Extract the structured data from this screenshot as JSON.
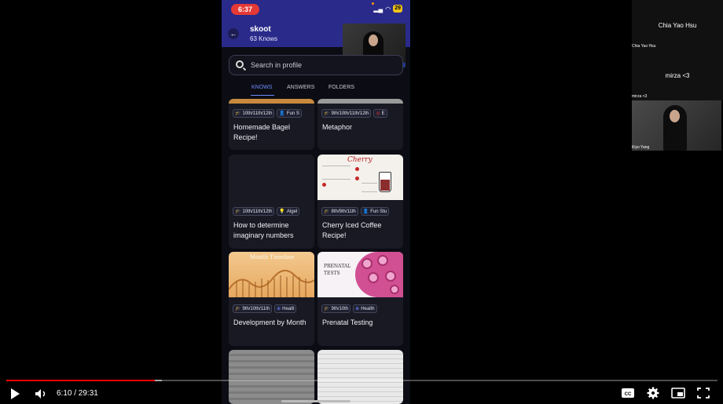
{
  "phone": {
    "status_time": "6:37",
    "battery": "29",
    "profile": {
      "name": "skoot",
      "subtitle": "63 Knows"
    },
    "search": {
      "placeholder": "Search in profile"
    },
    "tabs": [
      {
        "label": "KNOWS",
        "active": true
      },
      {
        "label": "ANSWERS",
        "active": false
      },
      {
        "label": "FOLDERS",
        "active": false
      }
    ],
    "cards": [
      {
        "tags": [
          "10th/11th/12th",
          "Fun S"
        ],
        "title": "Homemade Bagel Recipe!"
      },
      {
        "tags": [
          "9th/10th/11th/12th",
          "E"
        ],
        "title": "Metaphor"
      },
      {
        "tags": [
          "10th/11th/12th",
          "Algel"
        ],
        "title": "How to determine imaginary numbers"
      },
      {
        "tags": [
          "8th/9th/11th",
          "Fun Stu"
        ],
        "title": "Cherry Iced Coffee Recipe!"
      },
      {
        "tags": [
          "9th/10th/11th",
          "Healtl"
        ],
        "title": "Development by Month"
      },
      {
        "tags": [
          "9th/10th",
          "Health"
        ],
        "title": "Prenatal Testing"
      }
    ],
    "thumb_texts": {
      "cherry": "Cherry",
      "month": "Month Timeline",
      "prenatal": "PRENATAL TESTS"
    }
  },
  "participants": [
    {
      "display_name": "Chia Yao Hsu",
      "label": "Chia Yao Hsu"
    },
    {
      "display_name": "mirza <3",
      "label": "mirza <3"
    },
    {
      "display_name": "",
      "label": "Kiyo Yang"
    }
  ],
  "player": {
    "current_time": "6:10",
    "duration": "29:31",
    "time_display": "6:10 / 29:31",
    "progress_fraction": 0.209,
    "buffered_fraction": 0.219,
    "accent": "#ff0000"
  },
  "colors": {
    "header": "#2a2a8a",
    "tab_active": "#6d8bff",
    "time_pill": "#e53935"
  }
}
